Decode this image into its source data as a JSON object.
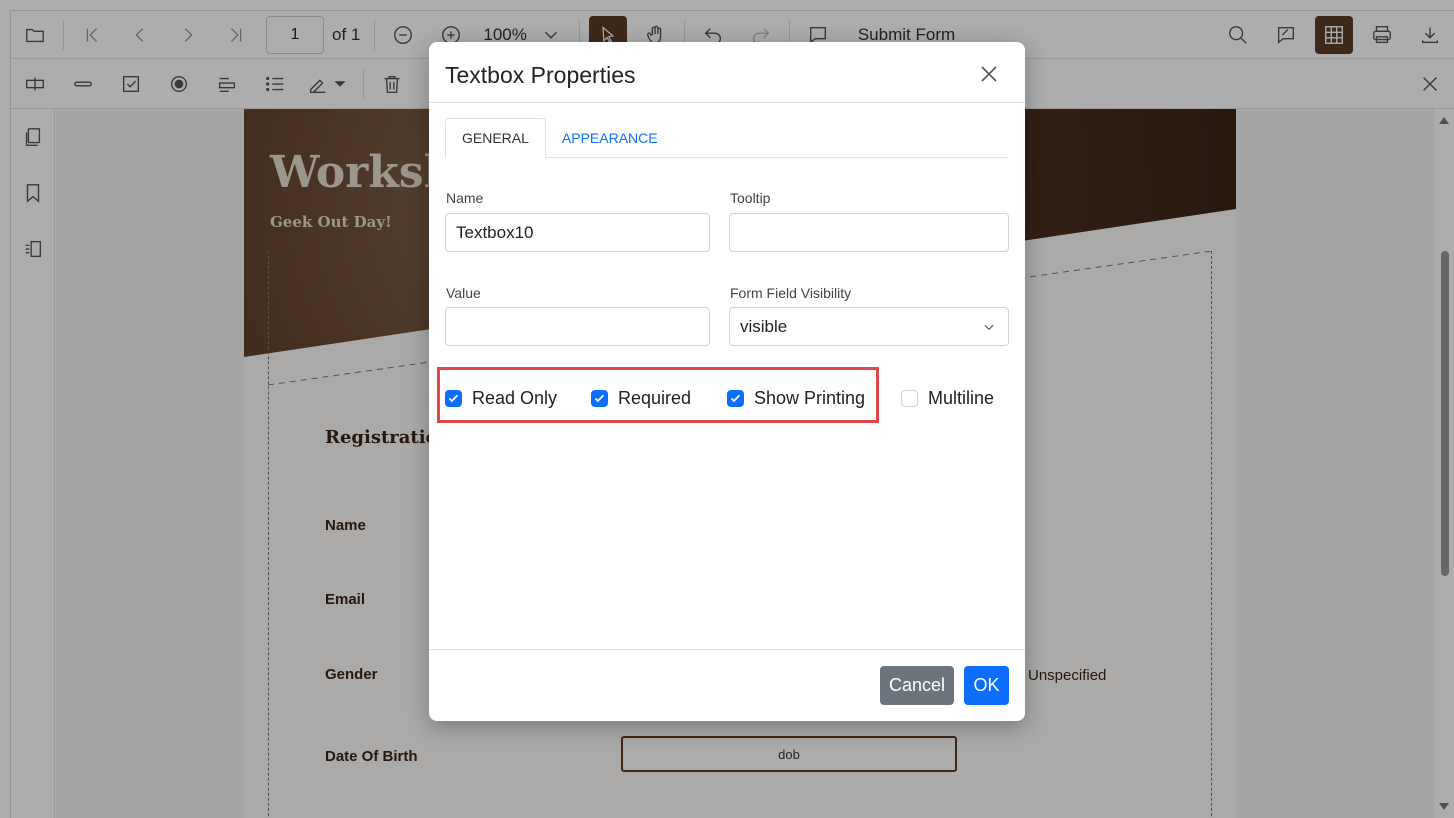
{
  "toolbar": {
    "page_number": "1",
    "page_of": "of 1",
    "zoom": "100%",
    "submit_form": "Submit Form"
  },
  "document": {
    "banner_title": "Worksh",
    "banner_subtitle": "Geek Out Day!",
    "registration_title": "Registratio",
    "labels": [
      "Name",
      "Email",
      "Gender",
      "Date Of Birth"
    ],
    "gender_option": "Unspecified",
    "dob_field": "dob"
  },
  "dialog": {
    "title": "Textbox Properties",
    "tabs": [
      "GENERAL",
      "APPEARANCE"
    ],
    "name_label": "Name",
    "name_value": "Textbox10",
    "tooltip_label": "Tooltip",
    "tooltip_value": "",
    "value_label": "Value",
    "value_value": "",
    "visibility_label": "Form Field Visibility",
    "visibility_value": "visible",
    "checkboxes": [
      {
        "label": "Read Only",
        "checked": true
      },
      {
        "label": "Required",
        "checked": true
      },
      {
        "label": "Show Printing",
        "checked": true
      },
      {
        "label": "Multiline",
        "checked": false
      }
    ],
    "cancel_label": "Cancel",
    "ok_label": "OK"
  },
  "colors": {
    "accent": "#0d6efd",
    "brand": "#5c3b27",
    "highlight": "#e0474c",
    "cancel": "#6c757d"
  }
}
